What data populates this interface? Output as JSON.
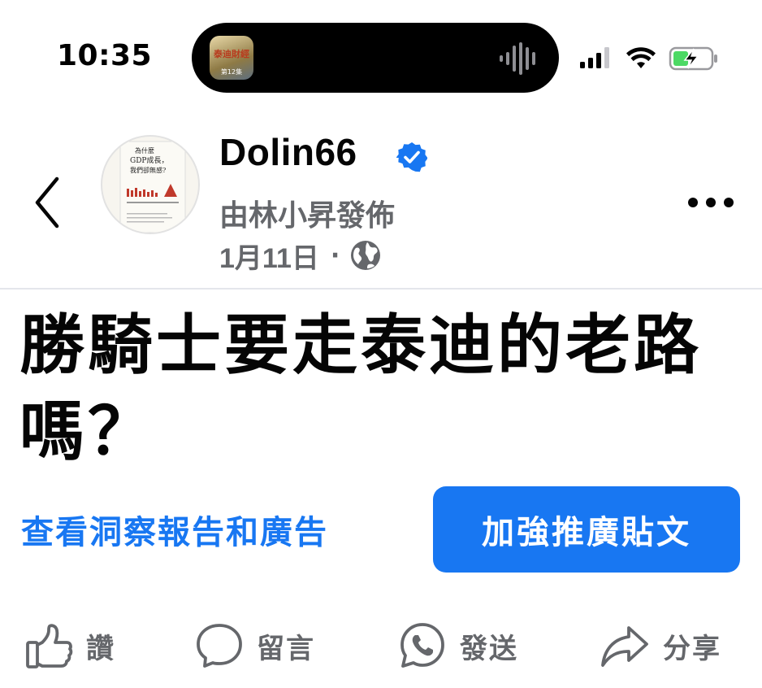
{
  "status_bar": {
    "time": "10:35",
    "island_app_title": "泰迪財經",
    "island_app_subtitle": "第12集",
    "icons": [
      "audio-wave-icon",
      "cellular-signal-icon",
      "wifi-icon",
      "battery-charging-icon"
    ],
    "battery_color": "#4cd964"
  },
  "header": {
    "page_name": "Dolin66",
    "publisher": "由林小昇發佈",
    "date": "1月11日",
    "separator": "·",
    "avatar_book": {
      "title_line1": "為什麼",
      "title_line2": "GDP成長，",
      "title_line3": "我們卻無感?"
    }
  },
  "post": {
    "text": "勝騎士要走泰迪的老路嗎？"
  },
  "actions": {
    "insights_link": "查看洞察報告和廣告",
    "boost_button": "加強推廣貼文"
  },
  "reactions": {
    "like": "讚",
    "comment": "留言",
    "send": "發送",
    "share": "分享"
  },
  "colors": {
    "brand_blue": "#1877f2",
    "secondary_text": "#65676b",
    "primary_text": "#050505"
  }
}
